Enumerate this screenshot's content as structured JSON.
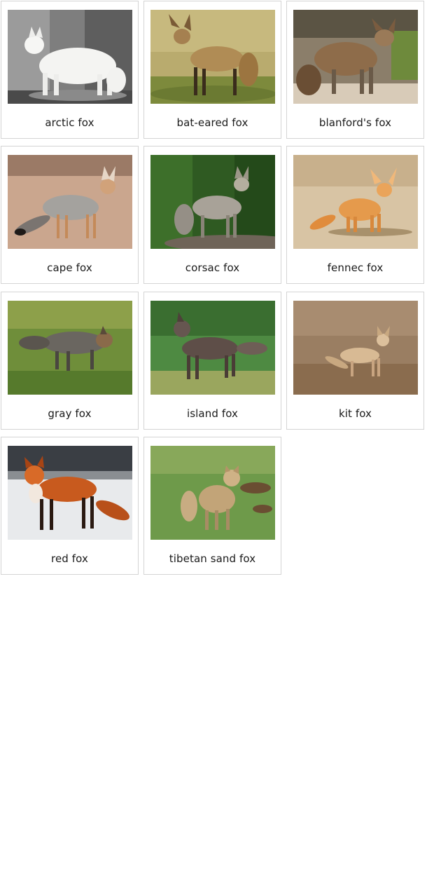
{
  "cards": [
    {
      "label": "arctic fox"
    },
    {
      "label": "bat-eared fox"
    },
    {
      "label": "blanford's fox"
    },
    {
      "label": "cape fox"
    },
    {
      "label": "corsac fox"
    },
    {
      "label": "fennec fox"
    },
    {
      "label": "gray fox"
    },
    {
      "label": "island fox"
    },
    {
      "label": "kit fox"
    },
    {
      "label": "red fox"
    },
    {
      "label": "tibetan sand fox"
    }
  ]
}
